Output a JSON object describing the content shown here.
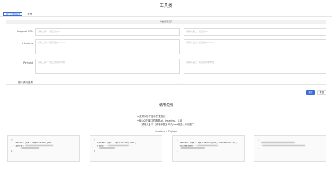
{
  "header": {
    "title": "工具类"
  },
  "tabs": [
    {
      "label": "接口并发测试",
      "active": true
    },
    {
      "label": "其他",
      "active": false
    }
  ],
  "section": {
    "title": "并发测试工具"
  },
  "form": {
    "request_url": {
      "label": "Request URL",
      "left_placeholder": "请输入第一个接口的url",
      "right_placeholder": "请输入第二个接口的url"
    },
    "headers": {
      "label": "Headers",
      "left_placeholder": "请输入第一个接口的Headers",
      "right_placeholder": "请输入第二个接口的Headers"
    },
    "payload": {
      "label": "Payload",
      "left_placeholder": "请输入第一个接口的请求参数",
      "right_placeholder": "请输入第二个接口的请求参数"
    },
    "result": {
      "label": "接口调用结果"
    }
  },
  "divider_mark": "•",
  "buttons": {
    "submit": "提交",
    "reset": "重置"
  },
  "usage": {
    "title": "使用说明",
    "items": [
      "支持对接口进行并发测试",
      "输入2个接口的请求url、headers、入参",
      "【请求头】与【请求参数】均为json格式，示例如下"
    ]
  },
  "example": {
    "title": "Headers + Payload",
    "boxes": [
      {
        "lines": [
          "{",
          "  \"Content-Type\":\"application/json\",",
          "  \"Cookie\":\"",
          "",
          "}"
        ]
      },
      {
        "lines": [
          "{",
          "  \"Content-Type\":\"application/json\",",
          "  \"Cookie\":\"",
          "",
          "}"
        ]
      },
      {
        "lines": [
          "{",
          "  \"Content-Type\":\"application/json; charset=UTF-8\",",
          "  \"AccessToken\":\"",
          "",
          "}"
        ]
      },
      {
        "lines": [
          "{",
          "  \"",
          "",
          "}"
        ]
      }
    ]
  }
}
